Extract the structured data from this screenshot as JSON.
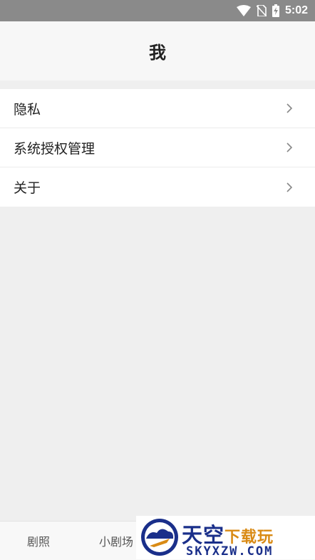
{
  "status_bar": {
    "time": "5:02"
  },
  "header": {
    "title": "我"
  },
  "menu": {
    "items": [
      {
        "label": "隐私"
      },
      {
        "label": "系统授权管理"
      },
      {
        "label": "关于"
      }
    ]
  },
  "tabbar": {
    "tabs": [
      {
        "label": "剧照"
      },
      {
        "label": "小剧场"
      }
    ]
  },
  "watermark": {
    "title_main": "天空",
    "title_accent": "下载玩",
    "url": "SKYXZW.COM"
  },
  "colors": {
    "status_bar": "#8a8a8a",
    "page_background": "#efefef",
    "watermark_blue": "#1a2f8a",
    "watermark_orange": "#d98a14"
  }
}
